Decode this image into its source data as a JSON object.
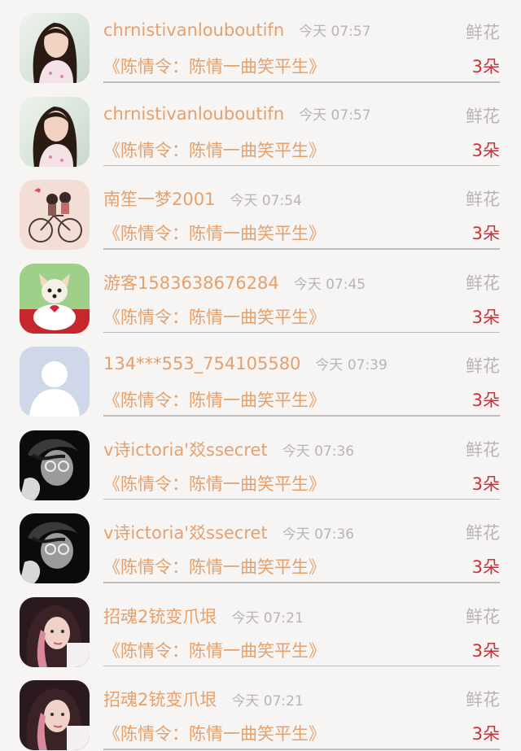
{
  "gift_list": {
    "items": [
      {
        "username": "chrnistivanlouboutifn",
        "time": "今天 07:57",
        "gift_type": "鲜花",
        "title": "《陈情令：陈情一曲笑平生》",
        "count": "3朵",
        "avatar": "girl-photo"
      },
      {
        "username": "chrnistivanlouboutifn",
        "time": "今天 07:57",
        "gift_type": "鲜花",
        "title": "《陈情令：陈情一曲笑平生》",
        "count": "3朵",
        "avatar": "girl-photo"
      },
      {
        "username": "南笙一梦2001",
        "time": "今天 07:54",
        "gift_type": "鲜花",
        "title": "《陈情令：陈情一曲笑平生》",
        "count": "3朵",
        "avatar": "bicycle-couple"
      },
      {
        "username": "游客1583638676284",
        "time": "今天 07:45",
        "gift_type": "鲜花",
        "title": "《陈情令：陈情一曲笑平生》",
        "count": "3朵",
        "avatar": "puppy-teacup"
      },
      {
        "username": "134***553_754105580",
        "time": "今天 07:39",
        "gift_type": "鲜花",
        "title": "《陈情令：陈情一曲笑平生》",
        "count": "3朵",
        "avatar": "default-user"
      },
      {
        "username": "v诗ictoria'㸚ssecret",
        "time": "今天 07:36",
        "gift_type": "鲜花",
        "title": "《陈情令：陈情一曲笑平生》",
        "count": "3朵",
        "avatar": "bw-portrait"
      },
      {
        "username": "v诗ictoria'㸚ssecret",
        "time": "今天 07:36",
        "gift_type": "鲜花",
        "title": "《陈情令：陈情一曲笑平生》",
        "count": "3朵",
        "avatar": "bw-portrait"
      },
      {
        "username": "招魂2铳变爪垠",
        "time": "今天 07:21",
        "gift_type": "鲜花",
        "title": "《陈情令：陈情一曲笑平生》",
        "count": "3朵",
        "avatar": "pink-hair-portrait"
      },
      {
        "username": "招魂2铳变爪垠",
        "time": "今天 07:21",
        "gift_type": "鲜花",
        "title": "《陈情令：陈情一曲笑平生》",
        "count": "3朵",
        "avatar": "pink-hair-portrait"
      }
    ]
  },
  "colors": {
    "username": "#e6a06b",
    "title": "#e6a06b",
    "count": "#c8323c",
    "muted": "#b8b4b4",
    "background": "#f7f4f4"
  }
}
